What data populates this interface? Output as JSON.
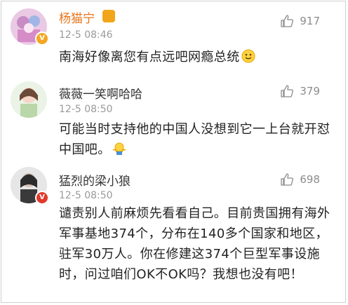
{
  "comments": [
    {
      "username": "杨猫宁",
      "timestamp": "12-5 08:46",
      "likes": "917",
      "text": "南海好像离您有点远吧网瘾总统",
      "emoji": "smile-emoji",
      "badge_color": "#f5a623"
    },
    {
      "username": "薇薇一笑啊哈哈",
      "timestamp": "12-5 08:50",
      "likes": "379",
      "text": "可能当时支持他的中国人没想到它一上台就开怼中国吧。",
      "emoji": "shrug-emoji"
    },
    {
      "username": "猛烈的梁小狼",
      "timestamp": "12-5 08:50",
      "likes": "698",
      "text": "谴责别人前麻烦先看看自己。目前贵国拥有海外军事基地374个，分布在140多个国家和地区，驻军30万人。你在修建这374个巨型军事设施时，问过咱们OK不OK吗？我想也没有吧！",
      "badge_color": "#e0392b"
    }
  ],
  "colors": {
    "highlight_name": "#e8731a",
    "meta_gray": "#9a9a9a",
    "text": "#222222"
  }
}
